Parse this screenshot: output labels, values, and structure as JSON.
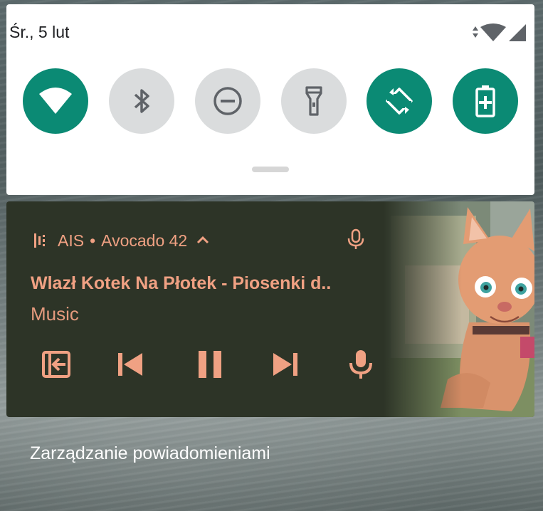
{
  "status_bar": {
    "date": "Śr., 5 lut"
  },
  "quick_settings": {
    "tiles": [
      {
        "name": "wifi",
        "state": "on",
        "icon": "wifi-icon"
      },
      {
        "name": "bluetooth",
        "state": "off",
        "icon": "bluetooth-icon"
      },
      {
        "name": "do-not-disturb",
        "state": "off",
        "icon": "do-not-disturb-icon"
      },
      {
        "name": "flashlight",
        "state": "off",
        "icon": "flashlight-icon"
      },
      {
        "name": "auto-rotate",
        "state": "on",
        "icon": "auto-rotate-icon"
      },
      {
        "name": "battery-saver",
        "state": "on",
        "icon": "battery-saver-icon"
      }
    ],
    "accent_color": "#0b8a74",
    "off_color": "#dadcdd"
  },
  "media_notification": {
    "app_name": "AIS",
    "separator": "•",
    "device": "Avocado 42",
    "title": "Wlazł Kotek Na Płotek - Piosenki d..",
    "subtitle": "Music",
    "accent_color": "#f0a183",
    "background_color": "#2d3427",
    "controls": [
      "exit-icon",
      "skip-previous-icon",
      "pause-icon",
      "skip-next-icon",
      "mic-icon"
    ]
  },
  "footer": {
    "manage_label": "Zarządzanie powiadomieniami"
  }
}
